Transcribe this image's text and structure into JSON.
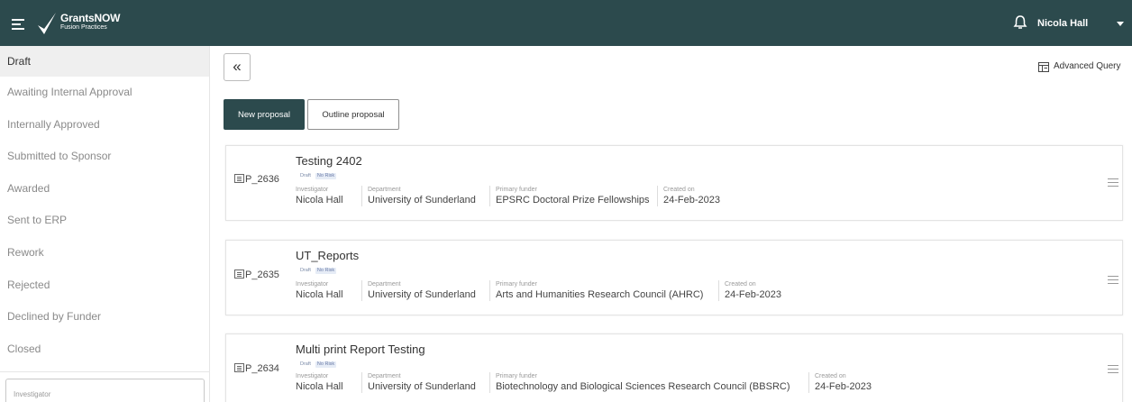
{
  "header": {
    "logo_title": "GrantsNOW",
    "logo_subtitle": "Fusion Practices",
    "user_name": "Nicola Hall"
  },
  "sidebar": {
    "items": [
      {
        "label": "Draft"
      },
      {
        "label": "Awaiting Internal Approval"
      },
      {
        "label": "Internally Approved"
      },
      {
        "label": "Submitted to Sponsor"
      },
      {
        "label": "Awarded"
      },
      {
        "label": "Sent to ERP"
      },
      {
        "label": "Rework"
      },
      {
        "label": "Rejected"
      },
      {
        "label": "Declined by Funder"
      },
      {
        "label": "Closed"
      }
    ],
    "filter_label": "Investigator"
  },
  "main": {
    "collapse_label": "«",
    "advanced_query_label": "Advanced Query",
    "new_proposal_label": "New proposal",
    "outline_proposal_label": "Outline proposal",
    "field_labels": {
      "investigator": "Investigator",
      "department": "Department",
      "primary_funder": "Primary funder",
      "created_on": "Created on"
    },
    "proposals": [
      {
        "id": "P_2636",
        "title": "Testing 2402",
        "status": "Draft",
        "risk": "No Risk",
        "investigator": "Nicola Hall",
        "department": "University of Sunderland",
        "primary_funder": "EPSRC Doctoral Prize Fellowships",
        "created_on": "24-Feb-2023"
      },
      {
        "id": "P_2635",
        "title": "UT_Reports",
        "status": "Draft",
        "risk": "No Risk",
        "investigator": "Nicola Hall",
        "department": "University of Sunderland",
        "primary_funder": "Arts and Humanities Research Council (AHRC)",
        "created_on": "24-Feb-2023"
      },
      {
        "id": "P_2634",
        "title": "Multi print Report Testing",
        "status": "Draft",
        "risk": "No Risk",
        "investigator": "Nicola Hall",
        "department": "University of Sunderland",
        "primary_funder": "Biotechnology and Biological Sciences Research Council (BBSRC)",
        "created_on": "24-Feb-2023"
      }
    ]
  },
  "colors": {
    "topbar": "#2c4a4d",
    "primary_button": "#2c4a4d",
    "badge_bg": "#e6ecf6"
  },
  "icons": [
    "menu-icon",
    "logo-icon",
    "bell-icon",
    "caret-down-icon",
    "advanced-query-icon",
    "document-icon",
    "card-menu-icon"
  ]
}
